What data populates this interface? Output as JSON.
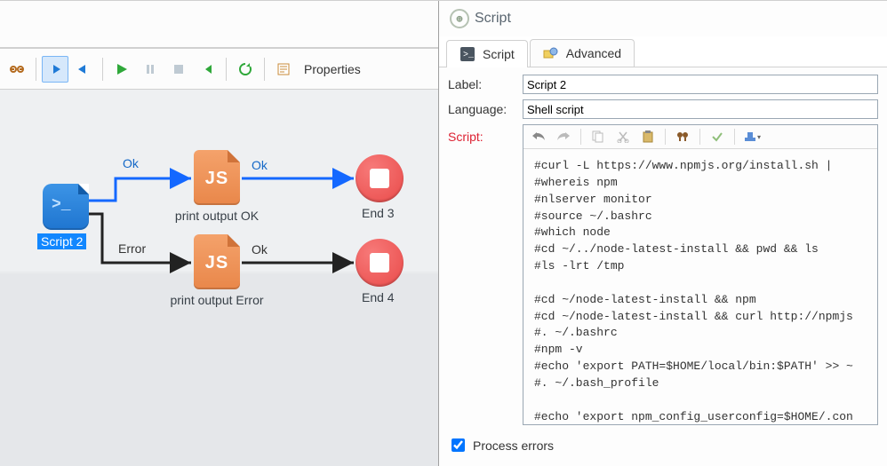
{
  "panel": {
    "title": "Script"
  },
  "tabs": {
    "script": "Script",
    "advanced": "Advanced"
  },
  "form": {
    "label_label": "Label:",
    "label_value": "Script 2",
    "language_label": "Language:",
    "language_value": "Shell script",
    "script_label": "Script:",
    "process_errors_label": "Process errors"
  },
  "toolbar": {
    "properties": "Properties"
  },
  "canvas": {
    "script2": "Script 2",
    "ok": "Ok",
    "error": "Error",
    "print_ok": "print output OK",
    "print_err": "print output Error",
    "end3": "End 3",
    "end4": "End 4"
  },
  "code": "#curl -L https://www.npmjs.org/install.sh | \n#whereis npm\n#nlserver monitor\n#source ~/.bashrc\n#which node\n#cd ~/../node-latest-install && pwd && ls\n#ls -lrt /tmp\n\n#cd ~/node-latest-install && npm\n#cd ~/node-latest-install && curl http://npmjs\n#. ~/.bashrc\n#npm -v\n#echo 'export PATH=$HOME/local/bin:$PATH' >> ~\n#. ~/.bash_profile\n\n#echo 'export npm_config_userconfig=$HOME/.con\n#. ~/.bashrc"
}
